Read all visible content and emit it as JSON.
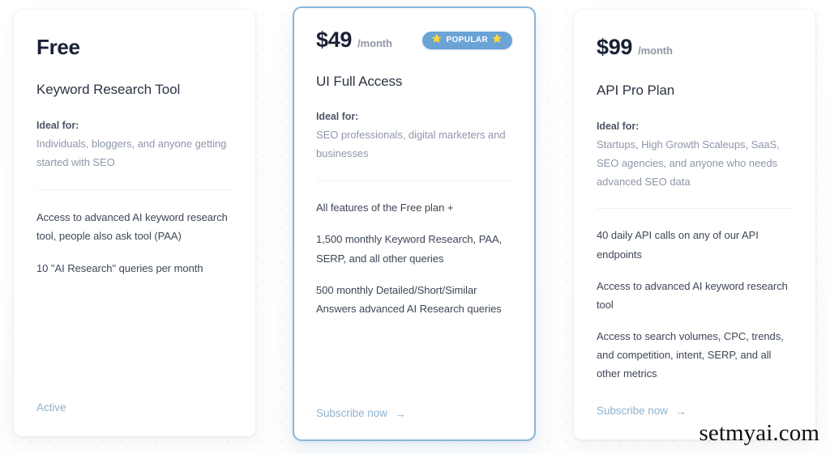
{
  "watermark": "setmyai.com",
  "plans": [
    {
      "price": "Free",
      "period": "",
      "name": "Keyword Research Tool",
      "ideal_label": "Ideal for:",
      "ideal_text": "Individuals, bloggers, and anyone getting started with SEO",
      "features": [
        "Access to advanced AI keyword research tool, people also ask tool (PAA)",
        "10 \"AI Research\" queries per month"
      ],
      "cta_label": "Active",
      "cta_arrow": "",
      "badge": null,
      "highlighted": false
    },
    {
      "price": "$49",
      "period": "/month",
      "name": "UI Full Access",
      "ideal_label": "Ideal for:",
      "ideal_text": "SEO professionals, digital marketers and businesses",
      "features": [
        "All features of the Free plan +",
        "1,500 monthly Keyword Research, PAA, SERP, and all other queries",
        "500 monthly Detailed/Short/Similar Answers advanced AI Research queries"
      ],
      "cta_label": "Subscribe now",
      "cta_arrow": "→",
      "badge": {
        "label": "POPULAR",
        "star": "⭐",
        "color": "#6ba3d6"
      },
      "highlighted": true
    },
    {
      "price": "$99",
      "period": "/month",
      "name": "API Pro Plan",
      "ideal_label": "Ideal for:",
      "ideal_text": "Startups, High Growth Scaleups, SaaS, SEO agencies, and anyone who needs advanced SEO data",
      "features": [
        "40 daily API calls on any of our API endpoints",
        "Access to advanced AI keyword research tool",
        "Access to search volumes, CPC, trends, and competition, intent, SERP, and all other metrics"
      ],
      "cta_label": "Subscribe now",
      "cta_arrow": "→",
      "badge": null,
      "highlighted": false
    }
  ],
  "colors": {
    "accent_border": "#8cb6d8",
    "badge_bg": "#6ba3d6",
    "cta_link": "#8fb2cd",
    "price_text": "#1a2035",
    "muted_text": "#8e97a8",
    "feature_text": "#3e4757"
  }
}
